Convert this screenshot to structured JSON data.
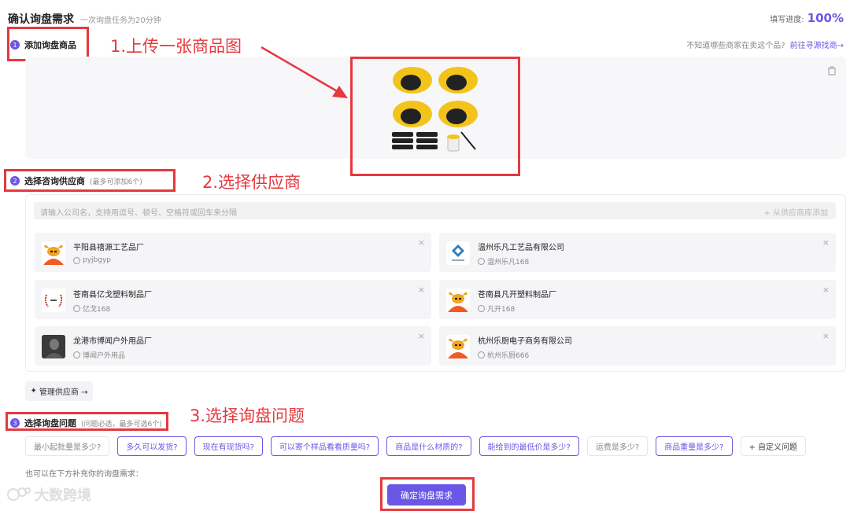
{
  "header": {
    "title": "确认询盘需求",
    "subtitle": "一次询盘任务为20分钟",
    "progress_label": "填写进度:",
    "progress_value": "100%"
  },
  "step1": {
    "num": "1",
    "label": "添加询盘商品",
    "hint_text": "不知道哪些商家在卖这个品?",
    "hint_link": "前往寻源找商→"
  },
  "step2": {
    "num": "2",
    "label": "选择咨询供应商",
    "note": "(最多可添加6个)"
  },
  "step3": {
    "num": "3",
    "label": "选择询盘问题",
    "note": "(问题必选，最多可选6个)"
  },
  "annotations": {
    "a1": "1.上传一张商品图",
    "a2": "2.选择供应商",
    "a3": "3.选择询盘问题"
  },
  "search": {
    "placeholder": "请输入公司名，支持用逗号、顿号、空格符或回车来分隔",
    "add_label": "+ 从供应商库添加"
  },
  "suppliers": [
    {
      "name": "平阳县禧源工艺品厂",
      "handle": "pyjbgyp",
      "logo": "bull-mascot"
    },
    {
      "name": "温州乐凡工艺品有限公司",
      "handle": "温州乐凡168",
      "logo": "diamond-logo"
    },
    {
      "name": "苍南县亿戈塑料制品厂",
      "handle": "亿戈168",
      "logo": "laurel-logo"
    },
    {
      "name": "苍南县凡开塑料制品厂",
      "handle": "凡开168",
      "logo": "bull-mascot"
    },
    {
      "name": "龙港市博闻户外用品厂",
      "handle": "博闻户外用品",
      "logo": "photo-avatar"
    },
    {
      "name": "杭州乐厨电子商务有限公司",
      "handle": "杭州乐厨666",
      "logo": "bull-mascot"
    }
  ],
  "manage_label": "管理供应商 →",
  "questions": [
    {
      "label": "最小起批量是多少?",
      "selected": false
    },
    {
      "label": "多久可以发货?",
      "selected": true
    },
    {
      "label": "现在有现货吗?",
      "selected": true
    },
    {
      "label": "可以寄个样品看看质量吗?",
      "selected": true
    },
    {
      "label": "商品是什么材质的?",
      "selected": true
    },
    {
      "label": "能给到的最低价是多少?",
      "selected": true
    },
    {
      "label": "运费是多少?",
      "selected": false
    },
    {
      "label": "商品重量是多少?",
      "selected": true
    },
    {
      "label": "+ 自定义问题",
      "selected": false
    }
  ],
  "extra_note": "也可以在下方补充你的询盘需求：",
  "submit_label": "确定询盘需求",
  "watermark": "大数跨境",
  "colors": {
    "accent": "#6b57e6",
    "annotation": "#e5393f"
  }
}
